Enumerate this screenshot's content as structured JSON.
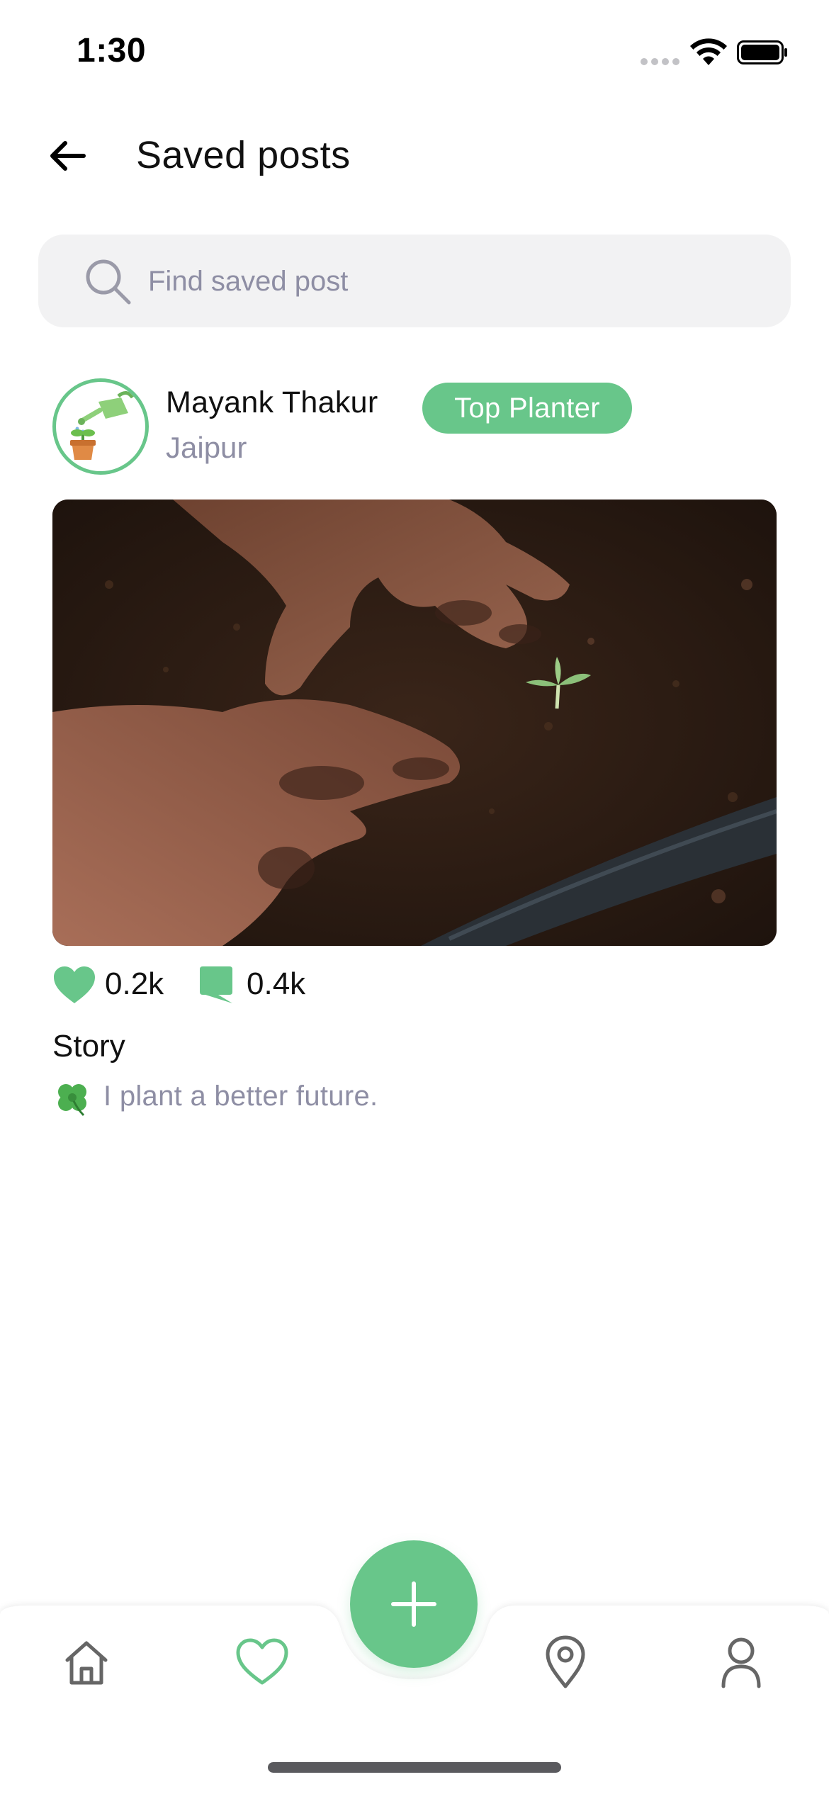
{
  "status_bar": {
    "time": "1:30"
  },
  "header": {
    "title": "Saved posts"
  },
  "search": {
    "placeholder": "Find saved post",
    "value": ""
  },
  "post": {
    "author_name": "Mayank Thakur",
    "location": "Jaipur",
    "badge": "Top Planter",
    "image_subject": "hands planting seedling in soil",
    "likes": "0.2k",
    "comments": "0.4k",
    "story_label": "Story",
    "story_text": "I plant a better future."
  },
  "bottom_nav": {
    "items": [
      {
        "name": "home",
        "icon": "home-icon",
        "active": false
      },
      {
        "name": "saved",
        "icon": "heart-icon",
        "active": true
      },
      {
        "name": "map",
        "icon": "map-pin-icon",
        "active": false
      },
      {
        "name": "profile",
        "icon": "user-icon",
        "active": false
      }
    ],
    "fab_icon": "plus-icon"
  },
  "colors": {
    "accent": "#68c68a",
    "muted_text": "#8e8ea4",
    "search_bg": "#f2f2f3",
    "nav_icon": "#666666"
  }
}
